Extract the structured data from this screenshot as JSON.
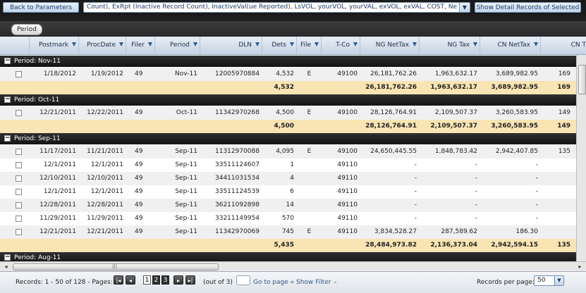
{
  "toolbar": {
    "back_label": "Back to Parameters",
    "combo_value": "Count), ExRpt (Inactive Record Count), InactiveVal(ue Reported), LsVOL, yourVOL, yourVAL, exVOL, exVAL, COST, NetTaxVal",
    "combo_arrow": "▼",
    "detail_label": "Show Detail Records of Selected"
  },
  "grouping": {
    "chip_label": "Period"
  },
  "columns": [
    "Postmark",
    "ProcDate",
    "Filer",
    "Period",
    "DLN",
    "Dets",
    "File",
    "T-Co",
    "NG NetTax",
    "NG Tax",
    "CN NetTax",
    "CN T"
  ],
  "groups": [
    {
      "title": "Period: Nov-11",
      "rows": [
        {
          "postmark": "1/18/2012",
          "procdate": "1/19/2012",
          "filer": "49",
          "period": "Nov-11",
          "dln": "12005970884",
          "dets": "4,532",
          "file": "E",
          "tco": "49100",
          "ngnet": "26,181,762.26",
          "ngtax": "1,963,632.17",
          "cnnet": "3,689,982.95",
          "cnt": "169"
        }
      ],
      "footer": {
        "dets": "4,532",
        "ngnet": "26,181,762.26",
        "ngtax": "1,963,632.17",
        "cnnet": "3,689,982.95",
        "cnt": "169"
      }
    },
    {
      "title": "Period: Oct-11",
      "rows": [
        {
          "postmark": "12/21/2011",
          "procdate": "12/22/2011",
          "filer": "49",
          "period": "Oct-11",
          "dln": "11342970268",
          "dets": "4,500",
          "file": "E",
          "tco": "49100",
          "ngnet": "28,126,764.91",
          "ngtax": "2,109,507.37",
          "cnnet": "3,260,583.95",
          "cnt": "149"
        }
      ],
      "footer": {
        "dets": "4,500",
        "ngnet": "28,126,764.91",
        "ngtax": "2,109,507.37",
        "cnnet": "3,260,583.95",
        "cnt": "149"
      }
    },
    {
      "title": "Period: Sep-11",
      "rows": [
        {
          "postmark": "11/17/2011",
          "procdate": "11/21/2011",
          "filer": "49",
          "period": "Sep-11",
          "dln": "11312970088",
          "dets": "4,095",
          "file": "E",
          "tco": "49100",
          "ngnet": "24,650,445.55",
          "ngtax": "1,848,783.42",
          "cnnet": "2,942,407.85",
          "cnt": "135"
        },
        {
          "postmark": "12/1/2011",
          "procdate": "12/1/2011",
          "filer": "49",
          "period": "Sep-11",
          "dln": "33511124607",
          "dets": "1",
          "file": "",
          "tco": "49110",
          "ngnet": "-",
          "ngtax": "-",
          "cnnet": "-",
          "cnt": ""
        },
        {
          "postmark": "12/10/2011",
          "procdate": "12/10/2011",
          "filer": "49",
          "period": "Sep-11",
          "dln": "34411031534",
          "dets": "4",
          "file": "",
          "tco": "49110",
          "ngnet": "-",
          "ngtax": "-",
          "cnnet": "-",
          "cnt": ""
        },
        {
          "postmark": "12/1/2011",
          "procdate": "12/1/2011",
          "filer": "49",
          "period": "Sep-11",
          "dln": "33511124539",
          "dets": "6",
          "file": "",
          "tco": "49110",
          "ngnet": "-",
          "ngtax": "-",
          "cnnet": "-",
          "cnt": ""
        },
        {
          "postmark": "12/28/2011",
          "procdate": "12/28/2011",
          "filer": "49",
          "period": "Sep-11",
          "dln": "36211092898",
          "dets": "14",
          "file": "",
          "tco": "49110",
          "ngnet": "-",
          "ngtax": "-",
          "cnnet": "-",
          "cnt": ""
        },
        {
          "postmark": "11/29/2011",
          "procdate": "11/29/2011",
          "filer": "49",
          "period": "Sep-11",
          "dln": "33211149954",
          "dets": "570",
          "file": "",
          "tco": "49110",
          "ngnet": "-",
          "ngtax": "-",
          "cnnet": "-",
          "cnt": ""
        },
        {
          "postmark": "12/21/2011",
          "procdate": "12/21/2011",
          "filer": "49",
          "period": "Sep-11",
          "dln": "11342970069",
          "dets": "745",
          "file": "E",
          "tco": "49110",
          "ngnet": "3,834,528.27",
          "ngtax": "287,589.62",
          "cnnet": "186.30",
          "cnt": ""
        }
      ],
      "footer": {
        "dets": "5,435",
        "ngnet": "28,484,973.82",
        "ngtax": "2,136,373.04",
        "cnnet": "2,942,594.15",
        "cnt": "135"
      }
    }
  ],
  "partial_group": "Period: Aug-11",
  "toggle_symbol": "−",
  "pager": {
    "records_text": "Records: 1 - 50 of 128 - Pages:",
    "first": "|◂",
    "prev": "◂",
    "pages": [
      "1",
      "2",
      "3"
    ],
    "next": "▸",
    "last": "▸|",
    "out_of": "(out of 3)",
    "goto_label": "Go to page »",
    "filter_label": "Show Filter",
    "dash": "-",
    "rpp_label": "Records per page:",
    "rpp_value": "50",
    "rpp_arrow": "▼"
  },
  "scroll": {
    "left_arrow": "◂",
    "right_arrow": "▸",
    "grip": "|||"
  }
}
